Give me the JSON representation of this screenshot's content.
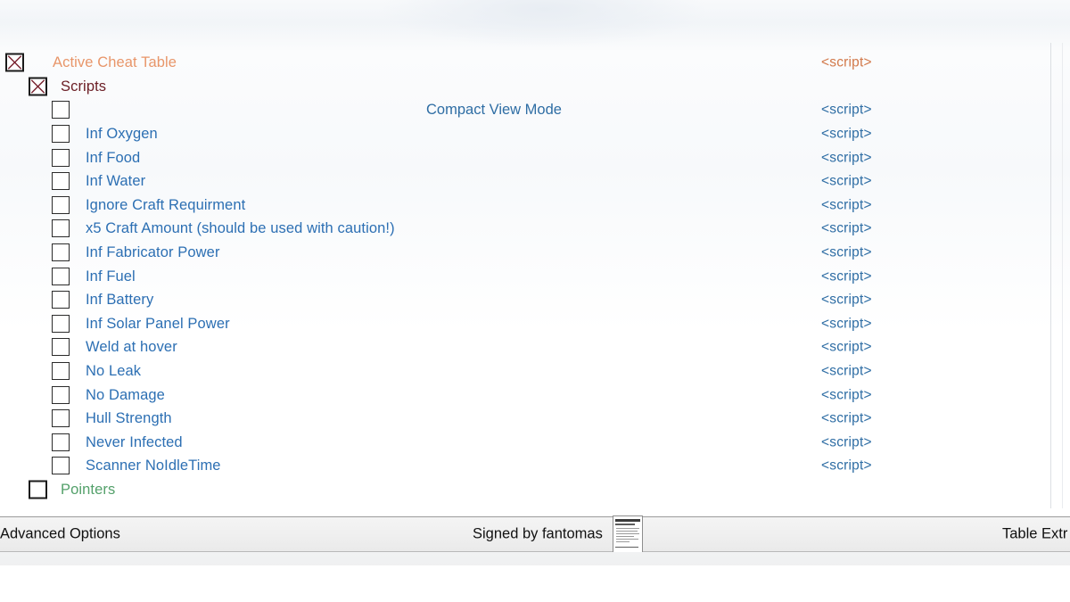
{
  "window": {
    "status_bar": {
      "advanced_options_label": "Advanced Options",
      "signed_by_label": "Signed by fantomas",
      "table_extras_label": "Table Extr",
      "certificate_icon": "certificate-thumbnail-icon"
    }
  },
  "tree": {
    "script_cell_label": "<script>",
    "compact_view_mode_label": "Compact View Mode",
    "colors": {
      "active_cheat_table": "#e8966a",
      "scripts_group": "#6b1d24",
      "pointers_group": "#53a06a",
      "script_entry": "#2c6fb3",
      "script_cell_blue": "#2e6da4",
      "script_cell_orange": "#d2794a",
      "checkbox_x": "#7a2430",
      "center_cell": "#2e6da4"
    },
    "rows": [
      {
        "label": "Active Cheat Table",
        "indent": 0,
        "checked": true,
        "color_key": "active_cheat_table",
        "script": "<script>",
        "script_color_key": "script_cell_orange",
        "center": ""
      },
      {
        "label": "Scripts",
        "indent": 1,
        "checked": true,
        "color_key": "scripts_group",
        "script": "",
        "script_color_key": "script_cell_blue",
        "center": ""
      },
      {
        "label": "",
        "indent": 2,
        "checked": false,
        "color_key": "script_entry",
        "script": "<script>",
        "script_color_key": "script_cell_blue",
        "center": "Compact View Mode"
      },
      {
        "label": "Inf Oxygen",
        "indent": 2,
        "checked": false,
        "color_key": "script_entry",
        "script": "<script>",
        "script_color_key": "script_cell_blue",
        "center": ""
      },
      {
        "label": "Inf Food",
        "indent": 2,
        "checked": false,
        "color_key": "script_entry",
        "script": "<script>",
        "script_color_key": "script_cell_blue",
        "center": ""
      },
      {
        "label": "Inf Water",
        "indent": 2,
        "checked": false,
        "color_key": "script_entry",
        "script": "<script>",
        "script_color_key": "script_cell_blue",
        "center": ""
      },
      {
        "label": "Ignore Craft Requirment",
        "indent": 2,
        "checked": false,
        "color_key": "script_entry",
        "script": "<script>",
        "script_color_key": "script_cell_blue",
        "center": ""
      },
      {
        "label": "x5 Craft Amount (should be used with caution!)",
        "indent": 2,
        "checked": false,
        "color_key": "script_entry",
        "script": "<script>",
        "script_color_key": "script_cell_blue",
        "center": ""
      },
      {
        "label": "Inf Fabricator Power",
        "indent": 2,
        "checked": false,
        "color_key": "script_entry",
        "script": "<script>",
        "script_color_key": "script_cell_blue",
        "center": ""
      },
      {
        "label": "Inf Fuel",
        "indent": 2,
        "checked": false,
        "color_key": "script_entry",
        "script": "<script>",
        "script_color_key": "script_cell_blue",
        "center": ""
      },
      {
        "label": "Inf Battery",
        "indent": 2,
        "checked": false,
        "color_key": "script_entry",
        "script": "<script>",
        "script_color_key": "script_cell_blue",
        "center": ""
      },
      {
        "label": "Inf Solar Panel Power",
        "indent": 2,
        "checked": false,
        "color_key": "script_entry",
        "script": "<script>",
        "script_color_key": "script_cell_blue",
        "center": ""
      },
      {
        "label": "Weld at hover",
        "indent": 2,
        "checked": false,
        "color_key": "script_entry",
        "script": "<script>",
        "script_color_key": "script_cell_blue",
        "center": ""
      },
      {
        "label": "No Leak",
        "indent": 2,
        "checked": false,
        "color_key": "script_entry",
        "script": "<script>",
        "script_color_key": "script_cell_blue",
        "center": ""
      },
      {
        "label": "No Damage",
        "indent": 2,
        "checked": false,
        "color_key": "script_entry",
        "script": "<script>",
        "script_color_key": "script_cell_blue",
        "center": ""
      },
      {
        "label": "Hull Strength",
        "indent": 2,
        "checked": false,
        "color_key": "script_entry",
        "script": "<script>",
        "script_color_key": "script_cell_blue",
        "center": ""
      },
      {
        "label": "Never Infected",
        "indent": 2,
        "checked": false,
        "color_key": "script_entry",
        "script": "<script>",
        "script_color_key": "script_cell_blue",
        "center": ""
      },
      {
        "label": "Scanner NoIdleTime",
        "indent": 2,
        "checked": false,
        "color_key": "script_entry",
        "script": "<script>",
        "script_color_key": "script_cell_blue",
        "center": ""
      },
      {
        "label": "Pointers",
        "indent": 1,
        "checked": false,
        "color_key": "pointers_group",
        "script": "",
        "script_color_key": "script_cell_blue",
        "center": ""
      }
    ]
  }
}
